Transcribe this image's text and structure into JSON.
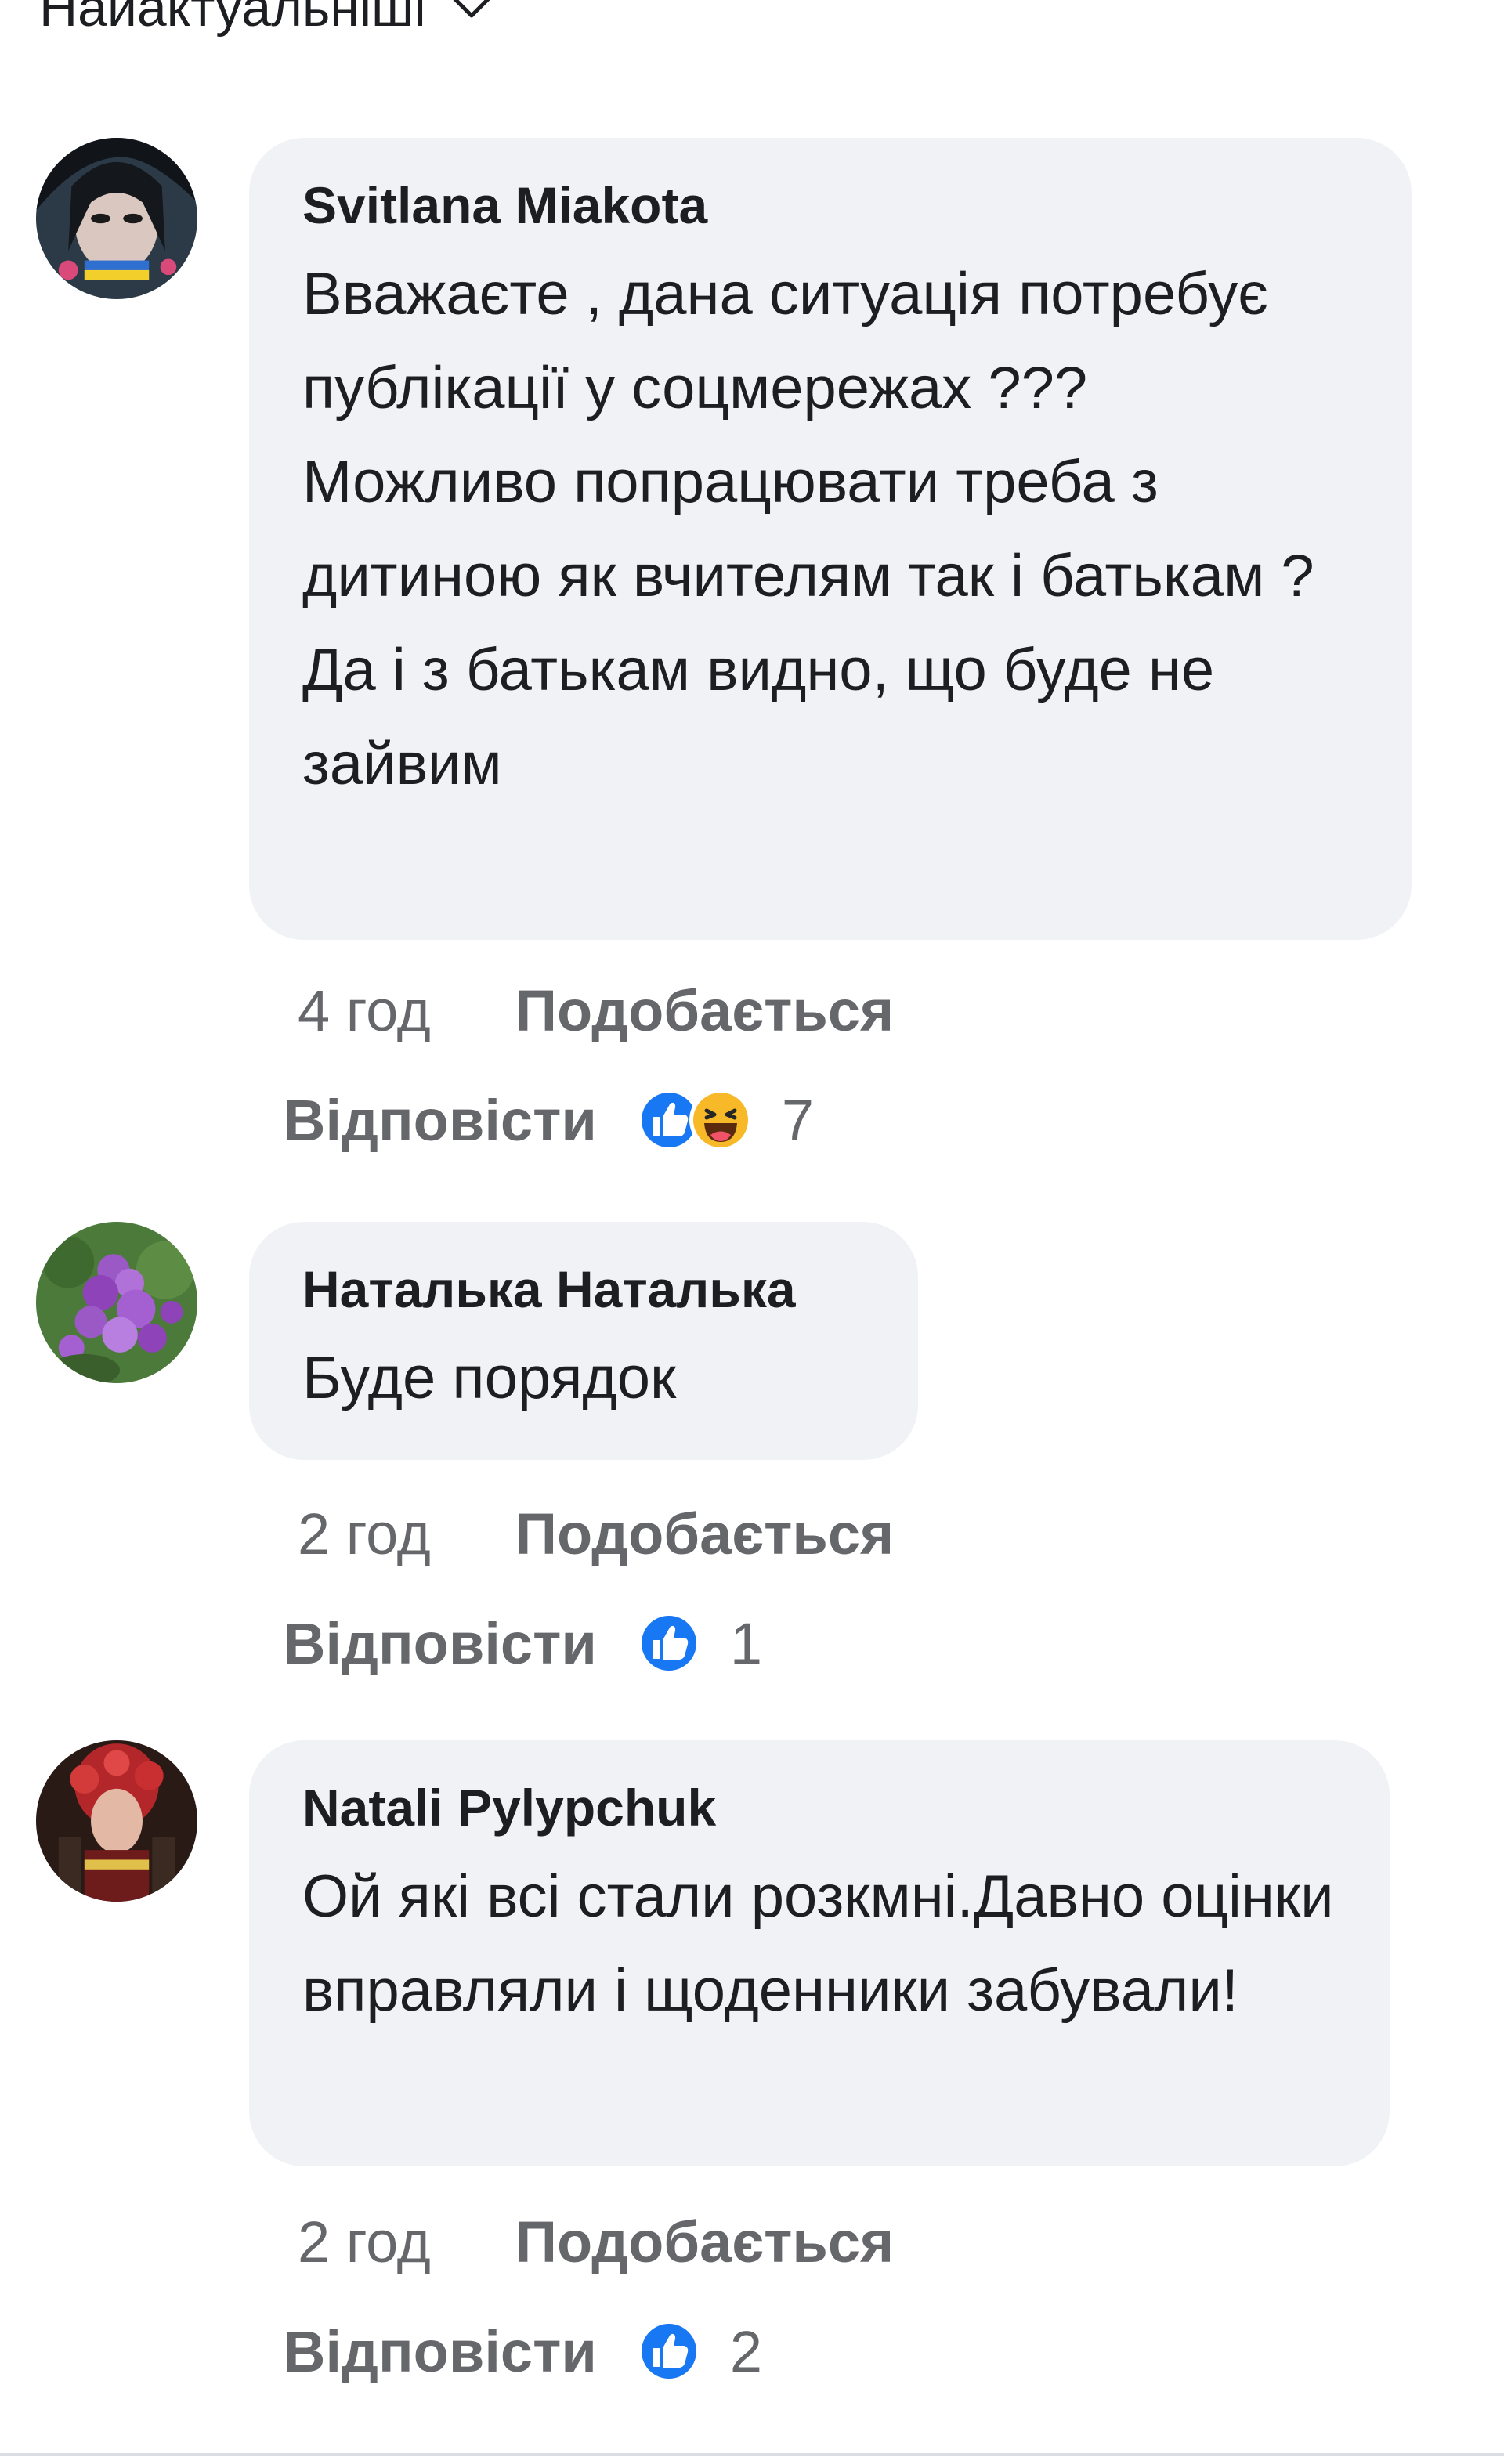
{
  "sort": {
    "label": "Найактуальніші"
  },
  "colors": {
    "bubble": "#f0f2f5",
    "like_blue": "#1877f2",
    "meta_gray": "#65676b"
  },
  "comments": [
    {
      "author": "Svitlana Miakota",
      "text": "Вважаєте , дана ситуація потребує публікації у соцмережах ??? Можливо попрацювати треба з дитиною як вчителям так і батькам ? Да і з батькам видно, що буде не зайвим",
      "time": "4 год",
      "like_label": "Подобається",
      "reply_label": "Відповісти",
      "reactions": [
        "like-icon",
        "haha-icon"
      ],
      "reaction_count": "7"
    },
    {
      "author": "Наталька Наталька",
      "text": "Буде порядок",
      "time": "2 год",
      "like_label": "Подобається",
      "reply_label": "Відповісти",
      "reactions": [
        "like-icon"
      ],
      "reaction_count": "1"
    },
    {
      "author": "Natali Pylypchuk",
      "text": "Ой які всі стали розкмні.Давно оцінки вправляли і щоденники забували!",
      "time": "2 год",
      "like_label": "Подобається",
      "reply_label": "Відповісти",
      "reactions": [
        "like-icon"
      ],
      "reaction_count": "2"
    }
  ]
}
